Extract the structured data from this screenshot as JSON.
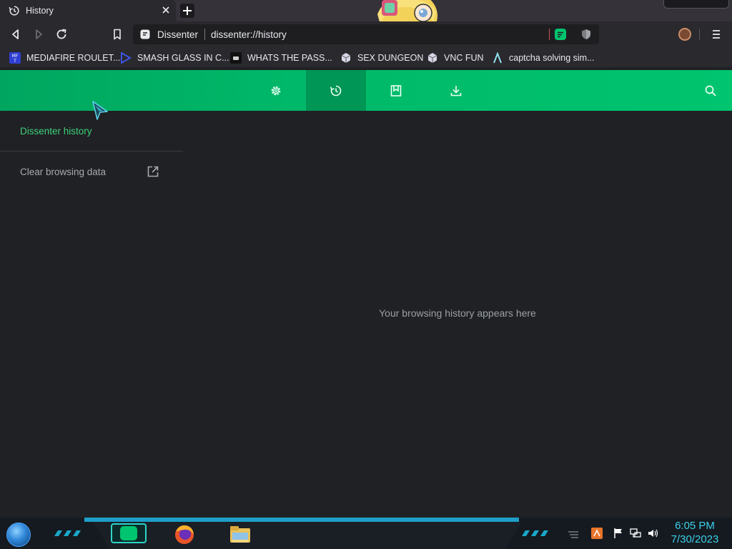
{
  "tab": {
    "title": "History"
  },
  "toolbar": {
    "site_name": "Dissenter",
    "url": "dissenter://history"
  },
  "bookmarks": [
    {
      "label": "MEDIAFIRE ROULET...",
      "icon": "mediafire-icon"
    },
    {
      "label": "SMASH GLASS IN C...",
      "icon": "sigma-icon"
    },
    {
      "label": "WHATS THE PASS...",
      "icon": "robot-icon"
    },
    {
      "label": "SEX DUNGEON",
      "icon": "cube-icon"
    },
    {
      "label": "VNC FUN",
      "icon": "cube-icon"
    },
    {
      "label": "captcha solving sim...",
      "icon": "lambda-icon"
    }
  ],
  "header": {
    "buttons": [
      {
        "name": "settings",
        "icon": "gear-icon",
        "active": false
      },
      {
        "name": "history",
        "icon": "history-icon",
        "active": true
      },
      {
        "name": "bookmarks",
        "icon": "bookmark-icon",
        "active": false
      },
      {
        "name": "downloads",
        "icon": "download-icon",
        "active": false
      }
    ],
    "search_icon": "search-icon"
  },
  "sidebar": {
    "title": "Dissenter history",
    "clear_label": "Clear browsing data"
  },
  "main": {
    "empty_message": "Your browsing history appears here"
  },
  "taskbar": {
    "time": "6:05 PM",
    "date": "7/30/2023",
    "apps": [
      "dissenter",
      "firefox",
      "file-explorer"
    ]
  },
  "colors": {
    "accent": "#00c46f",
    "accent_dark": "#009655",
    "sidebar_title": "#3ccf7a",
    "background": "#202124",
    "clock": "#3ad0e8"
  }
}
